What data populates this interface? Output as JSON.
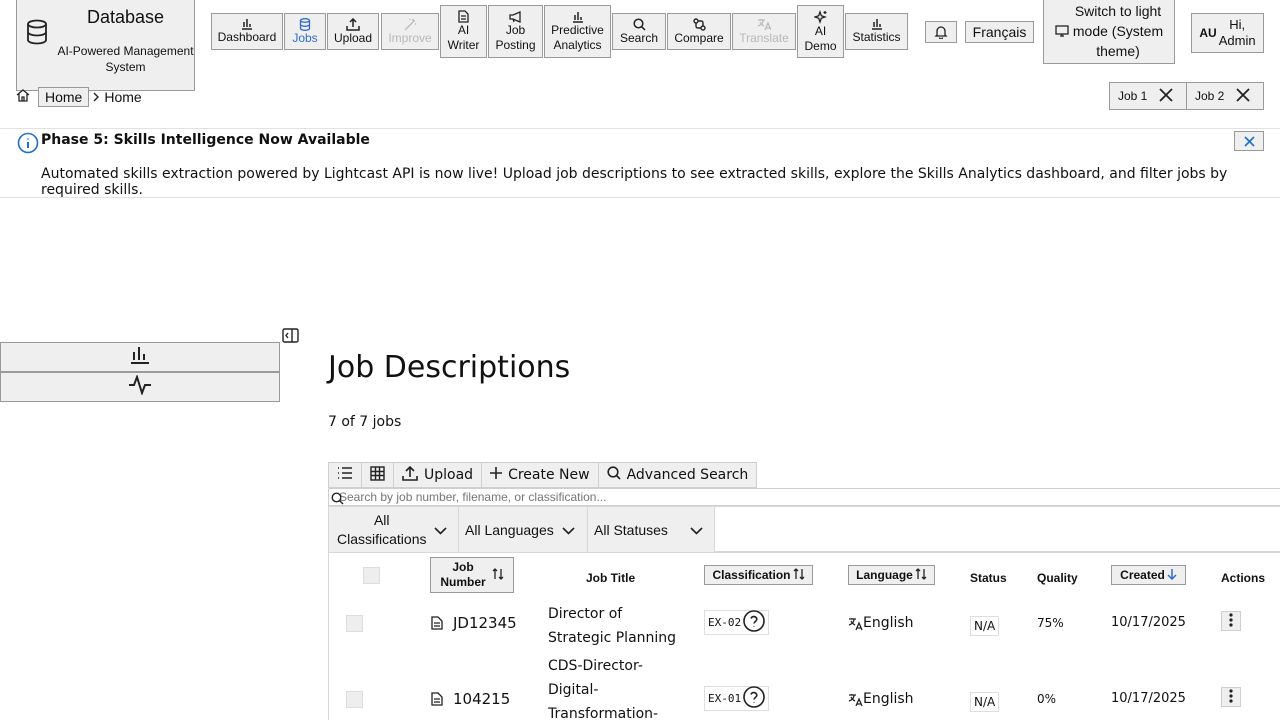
{
  "brand": {
    "title": "Database",
    "subtitle": "AI-Powered Management System",
    "icon": "database-icon"
  },
  "nav": {
    "dashboard": "Dashboard",
    "jobs": "Jobs",
    "upload": "Upload",
    "improve": "Improve",
    "ai_writer_1": "AI",
    "ai_writer_2": "Writer",
    "job_posting_1": "Job",
    "job_posting_2": "Posting",
    "predictive_1": "Predictive",
    "predictive_2": "Analytics",
    "search": "Search",
    "compare": "Compare",
    "translate": "Translate",
    "ai_demo_1": "AI",
    "ai_demo_2": "Demo",
    "statistics": "Statistics"
  },
  "header": {
    "language": "Français",
    "theme_line1": "Switch to light",
    "theme_line2": "mode (System",
    "theme_line3": "theme)",
    "avatar_initials": "AU",
    "greeting_1": "Hi,",
    "greeting_2": "Admin"
  },
  "breadcrumb": {
    "home_button": "Home",
    "current": "Home"
  },
  "tabs": [
    "Job 1",
    "Job 2"
  ],
  "banner": {
    "title": "Phase 5: Skills Intelligence Now Available",
    "text": "Automated skills extraction powered by Lightcast API is now live! Upload job descriptions to see extracted skills, explore the Skills Analytics dashboard, and filter jobs by required skills."
  },
  "page": {
    "title": "Job Descriptions",
    "count": "7 of 7 jobs"
  },
  "toolbar": {
    "upload": "Upload",
    "create_new": "Create New",
    "advanced_search": "Advanced Search"
  },
  "search": {
    "placeholder": "Search by job number, filename, or classification..."
  },
  "filters": {
    "classification_1": "All",
    "classification_2": "Classifications",
    "language": "All Languages",
    "status": "All Statuses"
  },
  "table": {
    "headers": {
      "job_number_1": "Job",
      "job_number_2": "Number",
      "job_title": "Job Title",
      "classification": "Classification",
      "language": "Language",
      "status": "Status",
      "quality": "Quality",
      "created": "Created",
      "actions": "Actions"
    },
    "rows": [
      {
        "job_number": "JD12345",
        "title_1": "Director of",
        "title_2": "Strategic Planning",
        "title_3": "",
        "classification": "EX-02",
        "language": "English",
        "status": "N/A",
        "quality": "75%",
        "created": "10/17/2025"
      },
      {
        "job_number": "104215",
        "title_1": "CDS-Director-",
        "title_2": "Digital-",
        "title_3": "Transformation-",
        "classification": "EX-01",
        "language": "English",
        "status": "N/A",
        "quality": "0%",
        "created": "10/17/2025"
      }
    ]
  },
  "colors": {
    "accent": "#2f6bd3",
    "info": "#1f6fd1",
    "button_bg": "#efefef"
  }
}
